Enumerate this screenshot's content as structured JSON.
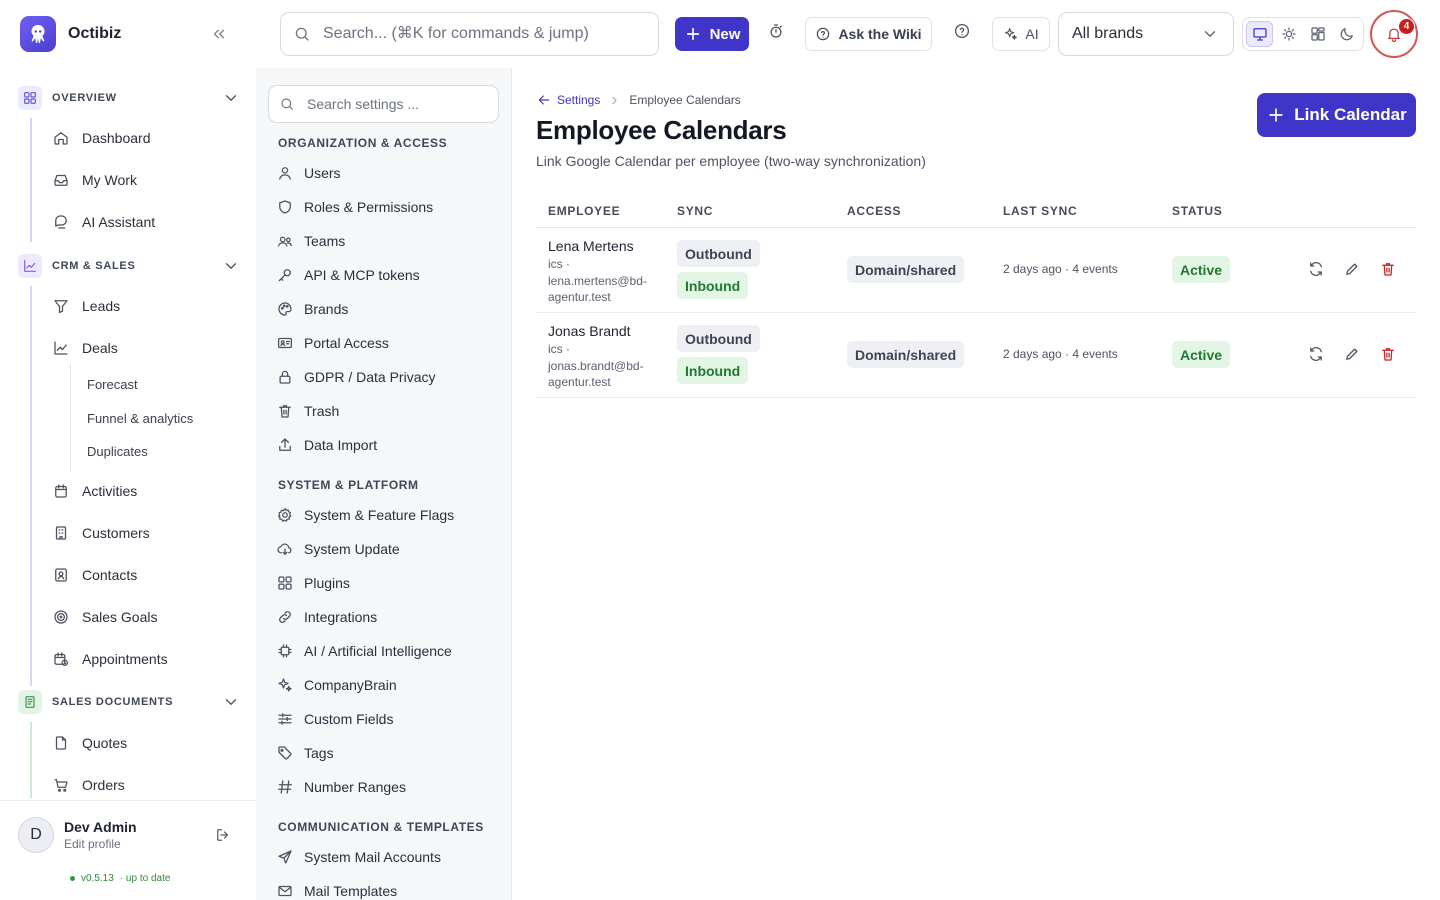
{
  "app": {
    "name": "Octibiz"
  },
  "topbar": {
    "search_placeholder": "Search... (⌘K for commands & jump)",
    "new_label": "New",
    "wiki_label": "Ask the Wiki",
    "ai_label": "AI",
    "brand_select": "All brands",
    "notifications_count": "4"
  },
  "sidebar": {
    "sections": [
      {
        "label": "OVERVIEW",
        "color": "#5b4fe0",
        "items": [
          "Dashboard",
          "My Work",
          "AI Assistant"
        ]
      },
      {
        "label": "CRM & SALES",
        "color": "#7b5ee8",
        "items": [
          "Leads",
          "Deals",
          "Activities",
          "Customers",
          "Contacts",
          "Sales Goals",
          "Appointments"
        ],
        "subitems": [
          "Forecast",
          "Funnel & analytics",
          "Duplicates"
        ]
      },
      {
        "label": "SALES DOCUMENTS",
        "color": "#2f9a46",
        "items": [
          "Quotes",
          "Orders"
        ]
      }
    ],
    "user": {
      "initial": "D",
      "name": "Dev Admin",
      "sub": "Edit profile"
    },
    "version": "v0.5.13",
    "version_status": "· up to date"
  },
  "settings": {
    "search_placeholder": "Search settings ...",
    "groups": [
      {
        "label": "ORGANIZATION & ACCESS",
        "items": [
          "Users",
          "Roles & Permissions",
          "Teams",
          "API & MCP tokens",
          "Brands",
          "Portal Access",
          "GDPR / Data Privacy",
          "Trash",
          "Data Import"
        ]
      },
      {
        "label": "SYSTEM & PLATFORM",
        "items": [
          "System & Feature Flags",
          "System Update",
          "Plugins",
          "Integrations",
          "AI / Artificial Intelligence",
          "CompanyBrain",
          "Custom Fields",
          "Tags",
          "Number Ranges"
        ]
      },
      {
        "label": "COMMUNICATION & TEMPLATES",
        "items": [
          "System Mail Accounts",
          "Mail Templates"
        ]
      }
    ]
  },
  "main": {
    "breadcrumb": {
      "parent": "Settings",
      "current": "Employee Calendars"
    },
    "title": "Employee Calendars",
    "subtitle": "Link Google Calendar per employee (two-way synchronization)",
    "link_button": "Link Calendar",
    "columns": [
      "EMPLOYEE",
      "SYNC",
      "ACCESS",
      "LAST SYNC",
      "STATUS"
    ],
    "rows": [
      {
        "name": "Lena Mertens",
        "sub": "ics · lena.mertens@bd-agentur.test",
        "sync_out": "Outbound",
        "sync_in": "Inbound",
        "access": "Domain/shared",
        "last_sync": "2 days ago · 4 events",
        "status": "Active"
      },
      {
        "name": "Jonas Brandt",
        "sub": "ics · jonas.brandt@bd-agentur.test",
        "sync_out": "Outbound",
        "sync_in": "Inbound",
        "access": "Domain/shared",
        "last_sync": "2 days ago · 4 events",
        "status": "Active"
      }
    ]
  },
  "colors": {
    "accent": "#3f35c8",
    "success": "#1f7a30",
    "danger": "#c81e1e"
  }
}
